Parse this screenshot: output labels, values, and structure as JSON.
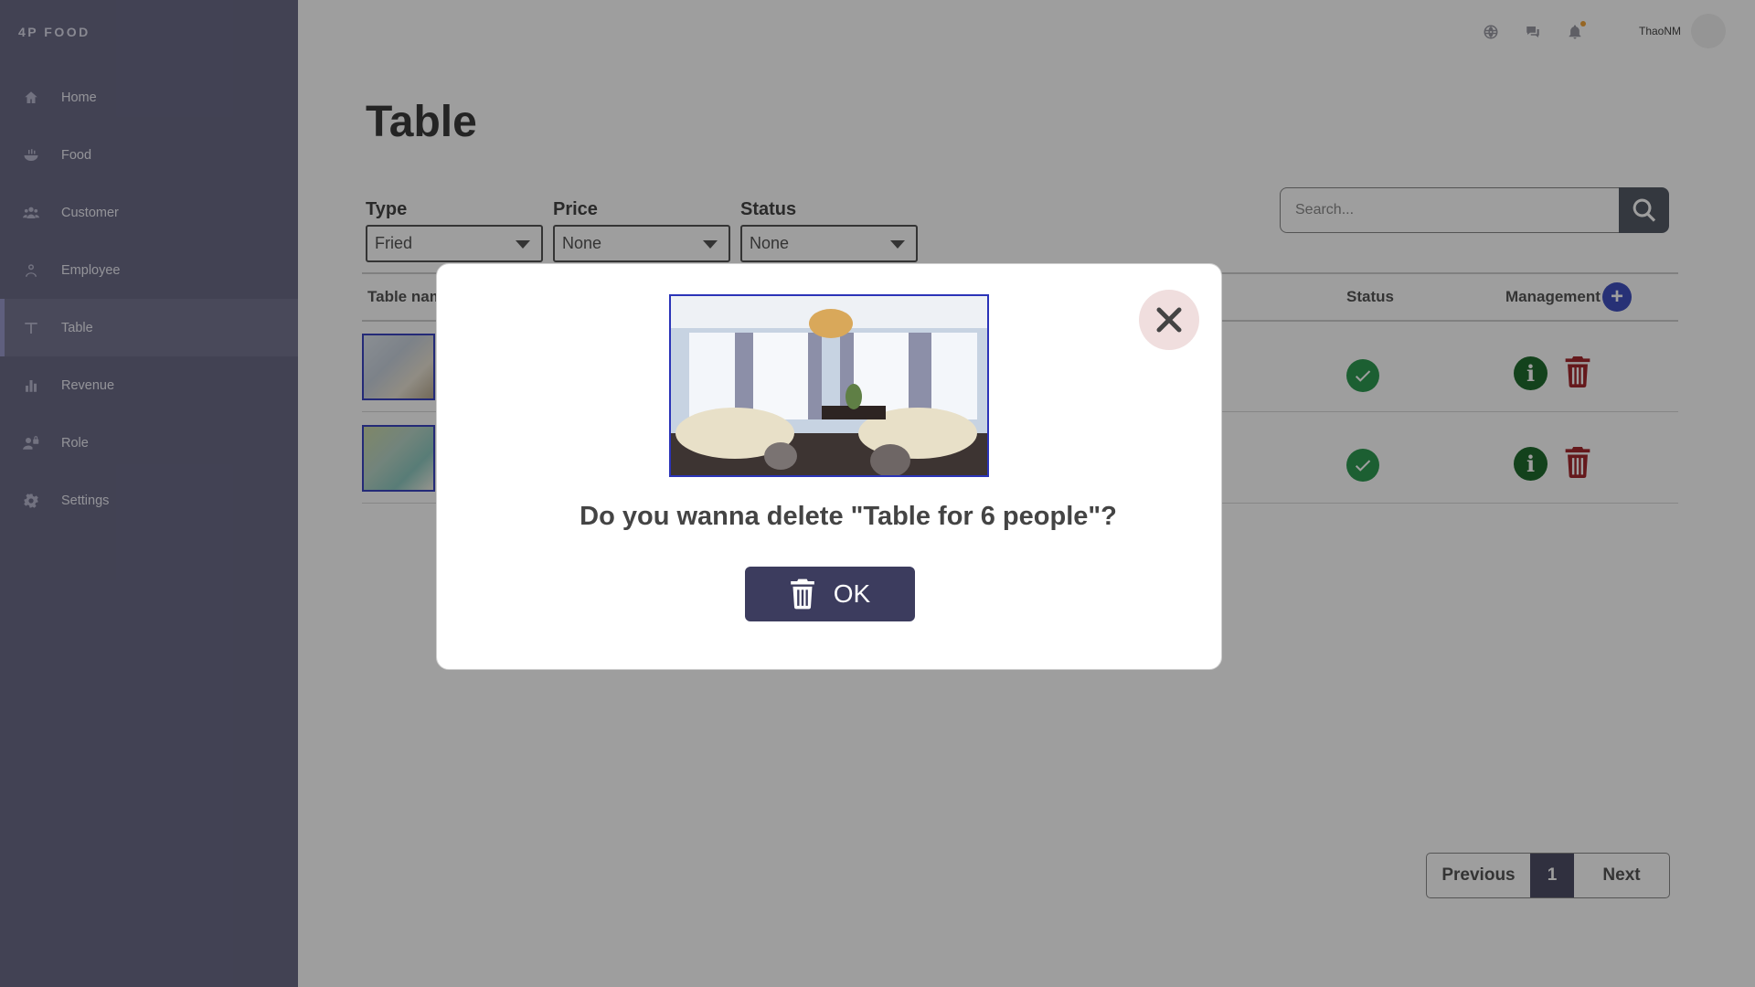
{
  "app": {
    "brand": "4P FOOD"
  },
  "sidebar": {
    "items": [
      {
        "label": "Home",
        "icon": "home-icon"
      },
      {
        "label": "Food",
        "icon": "food-bowl-icon"
      },
      {
        "label": "Customer",
        "icon": "users-icon"
      },
      {
        "label": "Employee",
        "icon": "user-icon"
      },
      {
        "label": "Table",
        "icon": "table-icon",
        "active": true
      },
      {
        "label": "Revenue",
        "icon": "bar-chart-icon"
      },
      {
        "label": "Role",
        "icon": "user-lock-icon"
      },
      {
        "label": "Settings",
        "icon": "gear-icon"
      }
    ]
  },
  "topbar": {
    "icons": [
      "globe-icon",
      "chat-icon",
      "bell-icon"
    ],
    "username": "ThaoNM"
  },
  "main": {
    "title": "Table",
    "filters": [
      {
        "label": "Type",
        "value": "Fried"
      },
      {
        "label": "Price",
        "value": "None"
      },
      {
        "label": "Status",
        "value": "None"
      }
    ],
    "search": {
      "placeholder": "Search..."
    },
    "table": {
      "headers": {
        "name": "Table nam",
        "status": "Status",
        "management": "Management"
      },
      "row_count": 2
    },
    "pagination": {
      "prev": "Previous",
      "current": "1",
      "next": "Next"
    }
  },
  "modal": {
    "message": "Do you wanna delete \"Table for 6 people\"?",
    "ok_label": "OK"
  },
  "colors": {
    "sidebar": "#6b6b87",
    "accent": "#3c3c5e",
    "success": "#2e9a52",
    "danger": "#a3292e"
  }
}
